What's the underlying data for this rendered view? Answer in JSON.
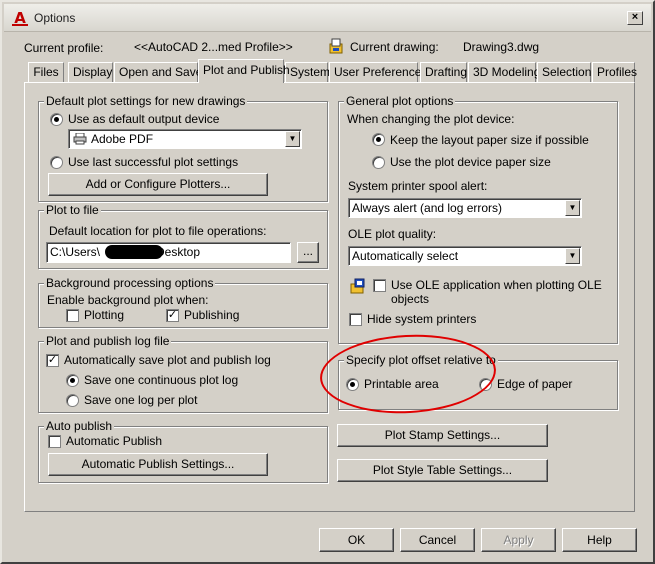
{
  "window": {
    "title": "Options",
    "close_glyph": "×",
    "app_icon": "autocad-a-icon",
    "app_letter": "A"
  },
  "header": {
    "current_profile_label": "Current profile:",
    "current_profile_value": "<<AutoCAD 2...med Profile>>",
    "current_drawing_label": "Current drawing:",
    "current_drawing_value": "Drawing3.dwg"
  },
  "tabs": [
    {
      "label": "Files"
    },
    {
      "label": "Display"
    },
    {
      "label": "Open and Save"
    },
    {
      "label": "Plot and Publish"
    },
    {
      "label": "System"
    },
    {
      "label": "User Preferences"
    },
    {
      "label": "Drafting"
    },
    {
      "label": "3D Modeling"
    },
    {
      "label": "Selection"
    },
    {
      "label": "Profiles"
    }
  ],
  "default_plot": {
    "legend": "Default plot settings for new drawings",
    "use_default_label": "Use as default output device",
    "device_value": "Adobe PDF",
    "use_last_label": "Use last successful plot settings",
    "add_plotters_button": "Add or Configure Plotters..."
  },
  "plot_to_file": {
    "legend": "Plot to file",
    "location_label": "Default location for plot to file operations:",
    "path_prefix": "C:\\Users\\",
    "path_suffix": "Desktop",
    "browse_button": "..."
  },
  "background": {
    "legend": "Background processing options",
    "enable_label": "Enable background plot when:",
    "plotting_label": "Plotting",
    "publishing_label": "Publishing"
  },
  "log": {
    "legend": "Plot and publish log file",
    "auto_save_label": "Automatically save plot and publish log",
    "one_continuous_label": "Save one continuous plot log",
    "one_per_plot_label": "Save one log per plot"
  },
  "auto_publish": {
    "legend": "Auto publish",
    "automatic_label": "Automatic Publish",
    "settings_button": "Automatic Publish Settings..."
  },
  "general": {
    "legend": "General plot options",
    "changing_label": "When changing the plot device:",
    "keep_layout_label": "Keep the layout paper size if possible",
    "use_device_label": "Use the plot device paper size",
    "spool_label": "System printer spool alert:",
    "spool_value": "Always alert (and log errors)",
    "ole_quality_label": "OLE plot quality:",
    "ole_quality_value": "Automatically select",
    "use_ole_label_line1": "Use OLE application when plotting OLE",
    "use_ole_label_line2": "objects",
    "hide_printers_label": "Hide system printers"
  },
  "offset": {
    "legend": "Specify plot offset relative to",
    "printable_label": "Printable area",
    "edge_label": "Edge of paper"
  },
  "right_buttons": {
    "stamp_button": "Plot Stamp Settings...",
    "style_table_button": "Plot Style Table Settings..."
  },
  "footer": {
    "ok": "OK",
    "cancel": "Cancel",
    "apply": "Apply",
    "help": "Help"
  },
  "glyphs": {
    "check": "✓",
    "arrow_down": "▼"
  }
}
